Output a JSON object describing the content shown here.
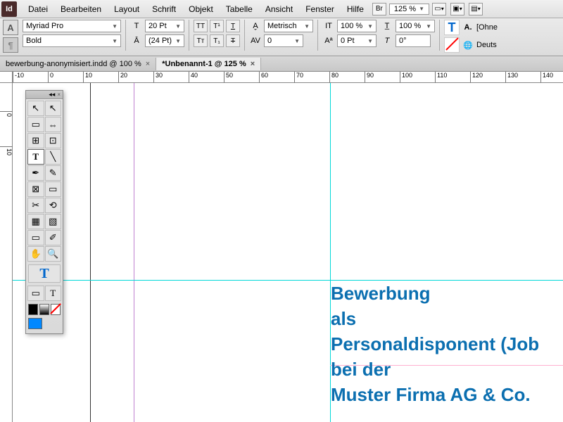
{
  "app_logo": "Id",
  "menu": [
    "Datei",
    "Bearbeiten",
    "Layout",
    "Schrift",
    "Objekt",
    "Tabelle",
    "Ansicht",
    "Fenster",
    "Hilfe"
  ],
  "zoom": "125 %",
  "br": "Br",
  "control": {
    "font": "Myriad Pro",
    "style": "Bold",
    "size": "20 Pt",
    "leading": "(24 Pt)",
    "kerning": "Metrisch",
    "tracking": "0",
    "vscale": "100 %",
    "hscale": "100 %",
    "baseline": "0 Pt",
    "skew": "0°",
    "no_style": "[Ohne",
    "lang": "Deuts"
  },
  "tabs": [
    {
      "label": "bewerbung-anonymisiert.indd @ 100 %",
      "active": false
    },
    {
      "label": "*Unbenannt-1 @ 125 %",
      "active": true
    }
  ],
  "ruler_marks": [
    -10,
    0,
    10,
    20,
    30,
    40,
    50,
    60,
    70,
    80,
    90,
    100,
    110,
    120,
    130,
    140
  ],
  "ruler_v_marks": [
    0,
    10
  ],
  "document_text": [
    "Bewerbung",
    "als",
    "Personaldisponent (Job",
    "bei der",
    "Muster Firma AG & Co. "
  ]
}
